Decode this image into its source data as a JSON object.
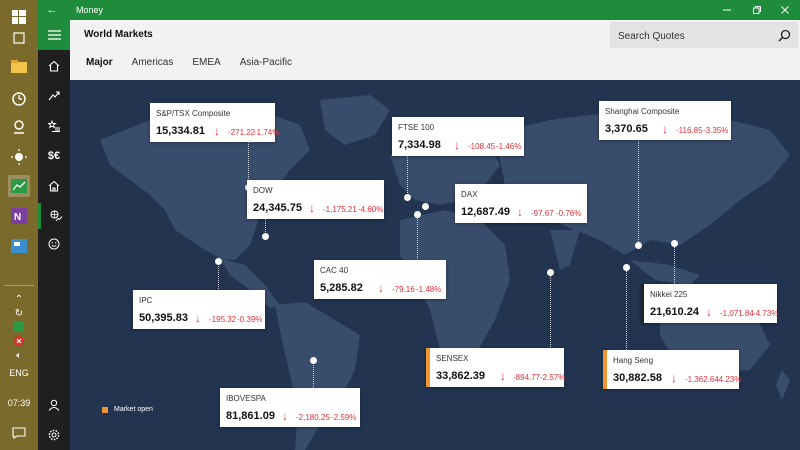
{
  "app": {
    "title": "Money"
  },
  "window": {
    "minimize_icon": "minimize-icon",
    "restore_icon": "restore-icon",
    "close_icon": "close-icon"
  },
  "taskbar": {
    "language": "ENG",
    "clock": "07:39",
    "items": [
      {
        "name": "windows-start-icon"
      },
      {
        "name": "task-view-icon"
      },
      {
        "name": "file-explorer-icon"
      },
      {
        "name": "alarms-icon"
      },
      {
        "name": "maps-icon"
      },
      {
        "name": "weather-icon"
      },
      {
        "name": "money-app-icon"
      },
      {
        "name": "onenote-icon"
      },
      {
        "name": "news-icon"
      }
    ]
  },
  "header": {
    "page_title": "World Markets",
    "search_placeholder": "Search Quotes",
    "tabs": [
      {
        "label": "Major"
      },
      {
        "label": "Americas"
      },
      {
        "label": "EMEA"
      },
      {
        "label": "Asia-Pacific"
      }
    ]
  },
  "legend": {
    "label": "Market open",
    "color": "#f29434"
  },
  "colors": {
    "accent": "#1e8c3a",
    "negative": "#e0313a",
    "map_bg": "#223450",
    "open_marker": "#f29434"
  },
  "markets": [
    {
      "name": "S&P/TSX Composite",
      "price": "15,334.81",
      "change": "-271.22",
      "percent": "-1.74%",
      "open": false
    },
    {
      "name": "DOW",
      "price": "24,345.75",
      "change": "-1,175.21",
      "percent": "-4.60%",
      "open": false
    },
    {
      "name": "IPC",
      "price": "50,395.83",
      "change": "-195.32",
      "percent": "-0.39%",
      "open": false
    },
    {
      "name": "IBOVESPA",
      "price": "81,861.09",
      "change": "-2,180.25",
      "percent": "-2.59%",
      "open": false
    },
    {
      "name": "FTSE 100",
      "price": "7,334.98",
      "change": "-108.45",
      "percent": "-1.46%",
      "open": false
    },
    {
      "name": "DAX",
      "price": "12,687.49",
      "change": "-97.67",
      "percent": "-0.76%",
      "open": false
    },
    {
      "name": "CAC 40",
      "price": "5,285.82",
      "change": "-79.16",
      "percent": "-1.48%",
      "open": false
    },
    {
      "name": "SENSEX",
      "price": "33,862.39",
      "change": "-894.77",
      "percent": "-2.57%",
      "open": true
    },
    {
      "name": "Shanghai Composite",
      "price": "3,370.65",
      "change": "-116.85",
      "percent": "-3.35%",
      "open": false
    },
    {
      "name": "Nikkei 225",
      "price": "21,610.24",
      "change": "-1,071.84",
      "percent": "-4.73%",
      "open": false
    },
    {
      "name": "Hang Seng",
      "price": "30,882.58",
      "change": "-1,362.64",
      "percent": "-4.23%",
      "open": true
    }
  ]
}
